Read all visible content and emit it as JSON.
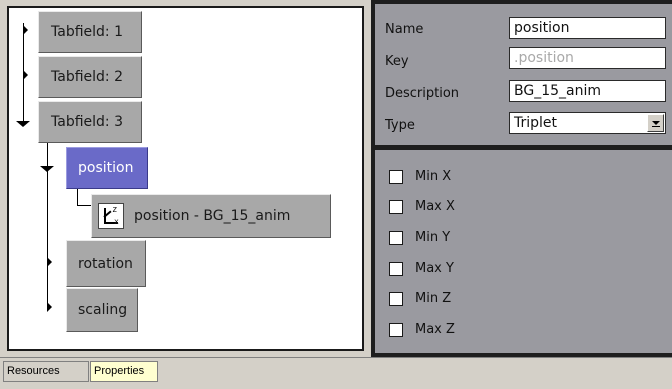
{
  "tree": {
    "nodes": {
      "tabfield1": "Tabfield: 1",
      "tabfield2": "Tabfield: 2",
      "tabfield3": "Tabfield: 3",
      "position": "position",
      "position_leaf": "position - BG_15_anim",
      "rotation": "rotation",
      "scaling": "scaling"
    },
    "selected": "position"
  },
  "properties": {
    "name_label": "Name",
    "name_value": "position",
    "key_label": "Key",
    "key_value": ".position",
    "description_label": "Description",
    "description_value": "BG_15_anim",
    "type_label": "Type",
    "type_value": "Triplet",
    "checkboxes": [
      {
        "label": "Min X",
        "checked": false
      },
      {
        "label": "Max X",
        "checked": false
      },
      {
        "label": "Min Y",
        "checked": false
      },
      {
        "label": "Max Y",
        "checked": false
      },
      {
        "label": "Min Z",
        "checked": false
      },
      {
        "label": "Max Z",
        "checked": false
      }
    ]
  },
  "tabs": {
    "resources": "Resources",
    "properties": "Properties",
    "active": "Properties"
  },
  "icons": {
    "collapsed": "triangle-right-icon",
    "expanded": "triangle-down-icon",
    "leaf": "xyz-axes-icon",
    "dropdown": "chevron-down-icon"
  },
  "colors": {
    "selected_node": "#6a6ac8",
    "node": "#a8a8a8",
    "panel": "#9a9aa0",
    "active_tab": "#ffffd0"
  }
}
